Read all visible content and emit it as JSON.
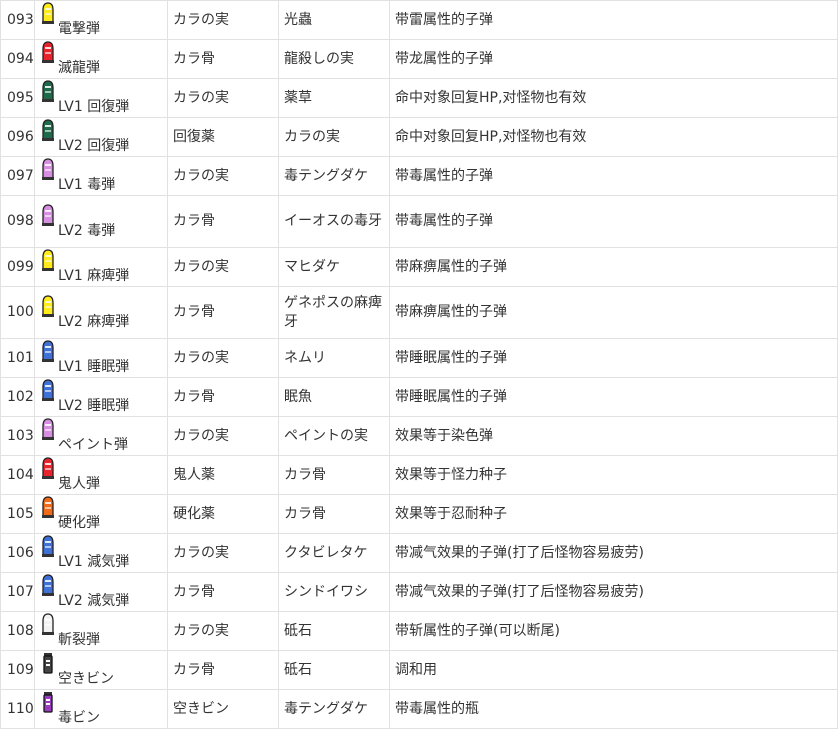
{
  "icons": {
    "ammo-yellow": "#ffea1a",
    "ammo-red": "#e8232b",
    "ammo-green": "#1f6a4b",
    "ammo-purple": "#d68ee0",
    "ammo-blue": "#3f70d6",
    "ammo-orange": "#f06a18",
    "ammo-white": "#f2f2f2",
    "vial-gray": "#444444",
    "vial-purple": "#9b3bbf"
  },
  "rows": [
    {
      "no": "093",
      "icon": "ammo-yellow",
      "name": "電撃弾",
      "m1": "カラの実",
      "m2": "光蟲",
      "desc": "带雷属性的子弹"
    },
    {
      "no": "094",
      "icon": "ammo-red",
      "name": "滅龍弾",
      "m1": "カラ骨",
      "m2": "龍殺しの実",
      "desc": "带龙属性的子弹"
    },
    {
      "no": "095",
      "icon": "ammo-green",
      "name": "LV1 回復弾",
      "m1": "カラの実",
      "m2": "薬草",
      "desc": "命中对象回复HP,对怪物也有效"
    },
    {
      "no": "096",
      "icon": "ammo-green",
      "name": "LV2 回復弾",
      "m1": "回復薬",
      "m2": "カラの実",
      "desc": "命中对象回复HP,对怪物也有效"
    },
    {
      "no": "097",
      "icon": "ammo-purple",
      "name": "LV1 毒弾",
      "m1": "カラの実",
      "m2": "毒テングダケ",
      "desc": "带毒属性的子弹"
    },
    {
      "no": "098",
      "icon": "ammo-purple",
      "name": "LV2 毒弾",
      "m1": "カラ骨",
      "m2": "イーオスの毒牙",
      "desc": "带毒属性的子弹"
    },
    {
      "no": "099",
      "icon": "ammo-yellow",
      "name": "LV1 麻痺弾",
      "m1": "カラの実",
      "m2": "マヒダケ",
      "desc": "带麻痹属性的子弹"
    },
    {
      "no": "100",
      "icon": "ammo-yellow",
      "name": "LV2 麻痺弾",
      "m1": "カラ骨",
      "m2": "ゲネポスの麻痺牙",
      "desc": "带麻痹属性的子弹"
    },
    {
      "no": "101",
      "icon": "ammo-blue",
      "name": "LV1 睡眠弾",
      "m1": "カラの実",
      "m2": "ネムリ",
      "desc": "带睡眠属性的子弹"
    },
    {
      "no": "102",
      "icon": "ammo-blue",
      "name": "LV2 睡眠弾",
      "m1": "カラ骨",
      "m2": "眠魚",
      "desc": "带睡眠属性的子弹"
    },
    {
      "no": "103",
      "icon": "ammo-purple",
      "name": "ペイント弾",
      "m1": "カラの実",
      "m2": "ペイントの実",
      "desc": "效果等于染色弹"
    },
    {
      "no": "104",
      "icon": "ammo-red",
      "name": "鬼人弾",
      "m1": "鬼人薬",
      "m2": "カラ骨",
      "desc": "效果等于怪力种子"
    },
    {
      "no": "105",
      "icon": "ammo-orange",
      "name": "硬化弾",
      "m1": "硬化薬",
      "m2": "カラ骨",
      "desc": "效果等于忍耐种子"
    },
    {
      "no": "106",
      "icon": "ammo-blue",
      "name": "LV1 減気弾",
      "m1": "カラの実",
      "m2": "クタビレタケ",
      "desc": "带减气效果的子弹(打了后怪物容易疲劳)"
    },
    {
      "no": "107",
      "icon": "ammo-blue",
      "name": "LV2 減気弾",
      "m1": "カラ骨",
      "m2": "シンドイワシ",
      "desc": "带减气效果的子弹(打了后怪物容易疲劳)"
    },
    {
      "no": "108",
      "icon": "ammo-white",
      "name": "斬裂弾",
      "m1": "カラの実",
      "m2": "砥石",
      "desc": "带斩属性的子弹(可以断尾)"
    },
    {
      "no": "109",
      "icon": "vial-gray",
      "name": "空きビン",
      "m1": "カラ骨",
      "m2": "砥石",
      "desc": "调和用"
    },
    {
      "no": "110",
      "icon": "vial-purple",
      "name": "毒ビン",
      "m1": "空きビン",
      "m2": "毒テングダケ",
      "desc": "带毒属性的瓶"
    }
  ]
}
